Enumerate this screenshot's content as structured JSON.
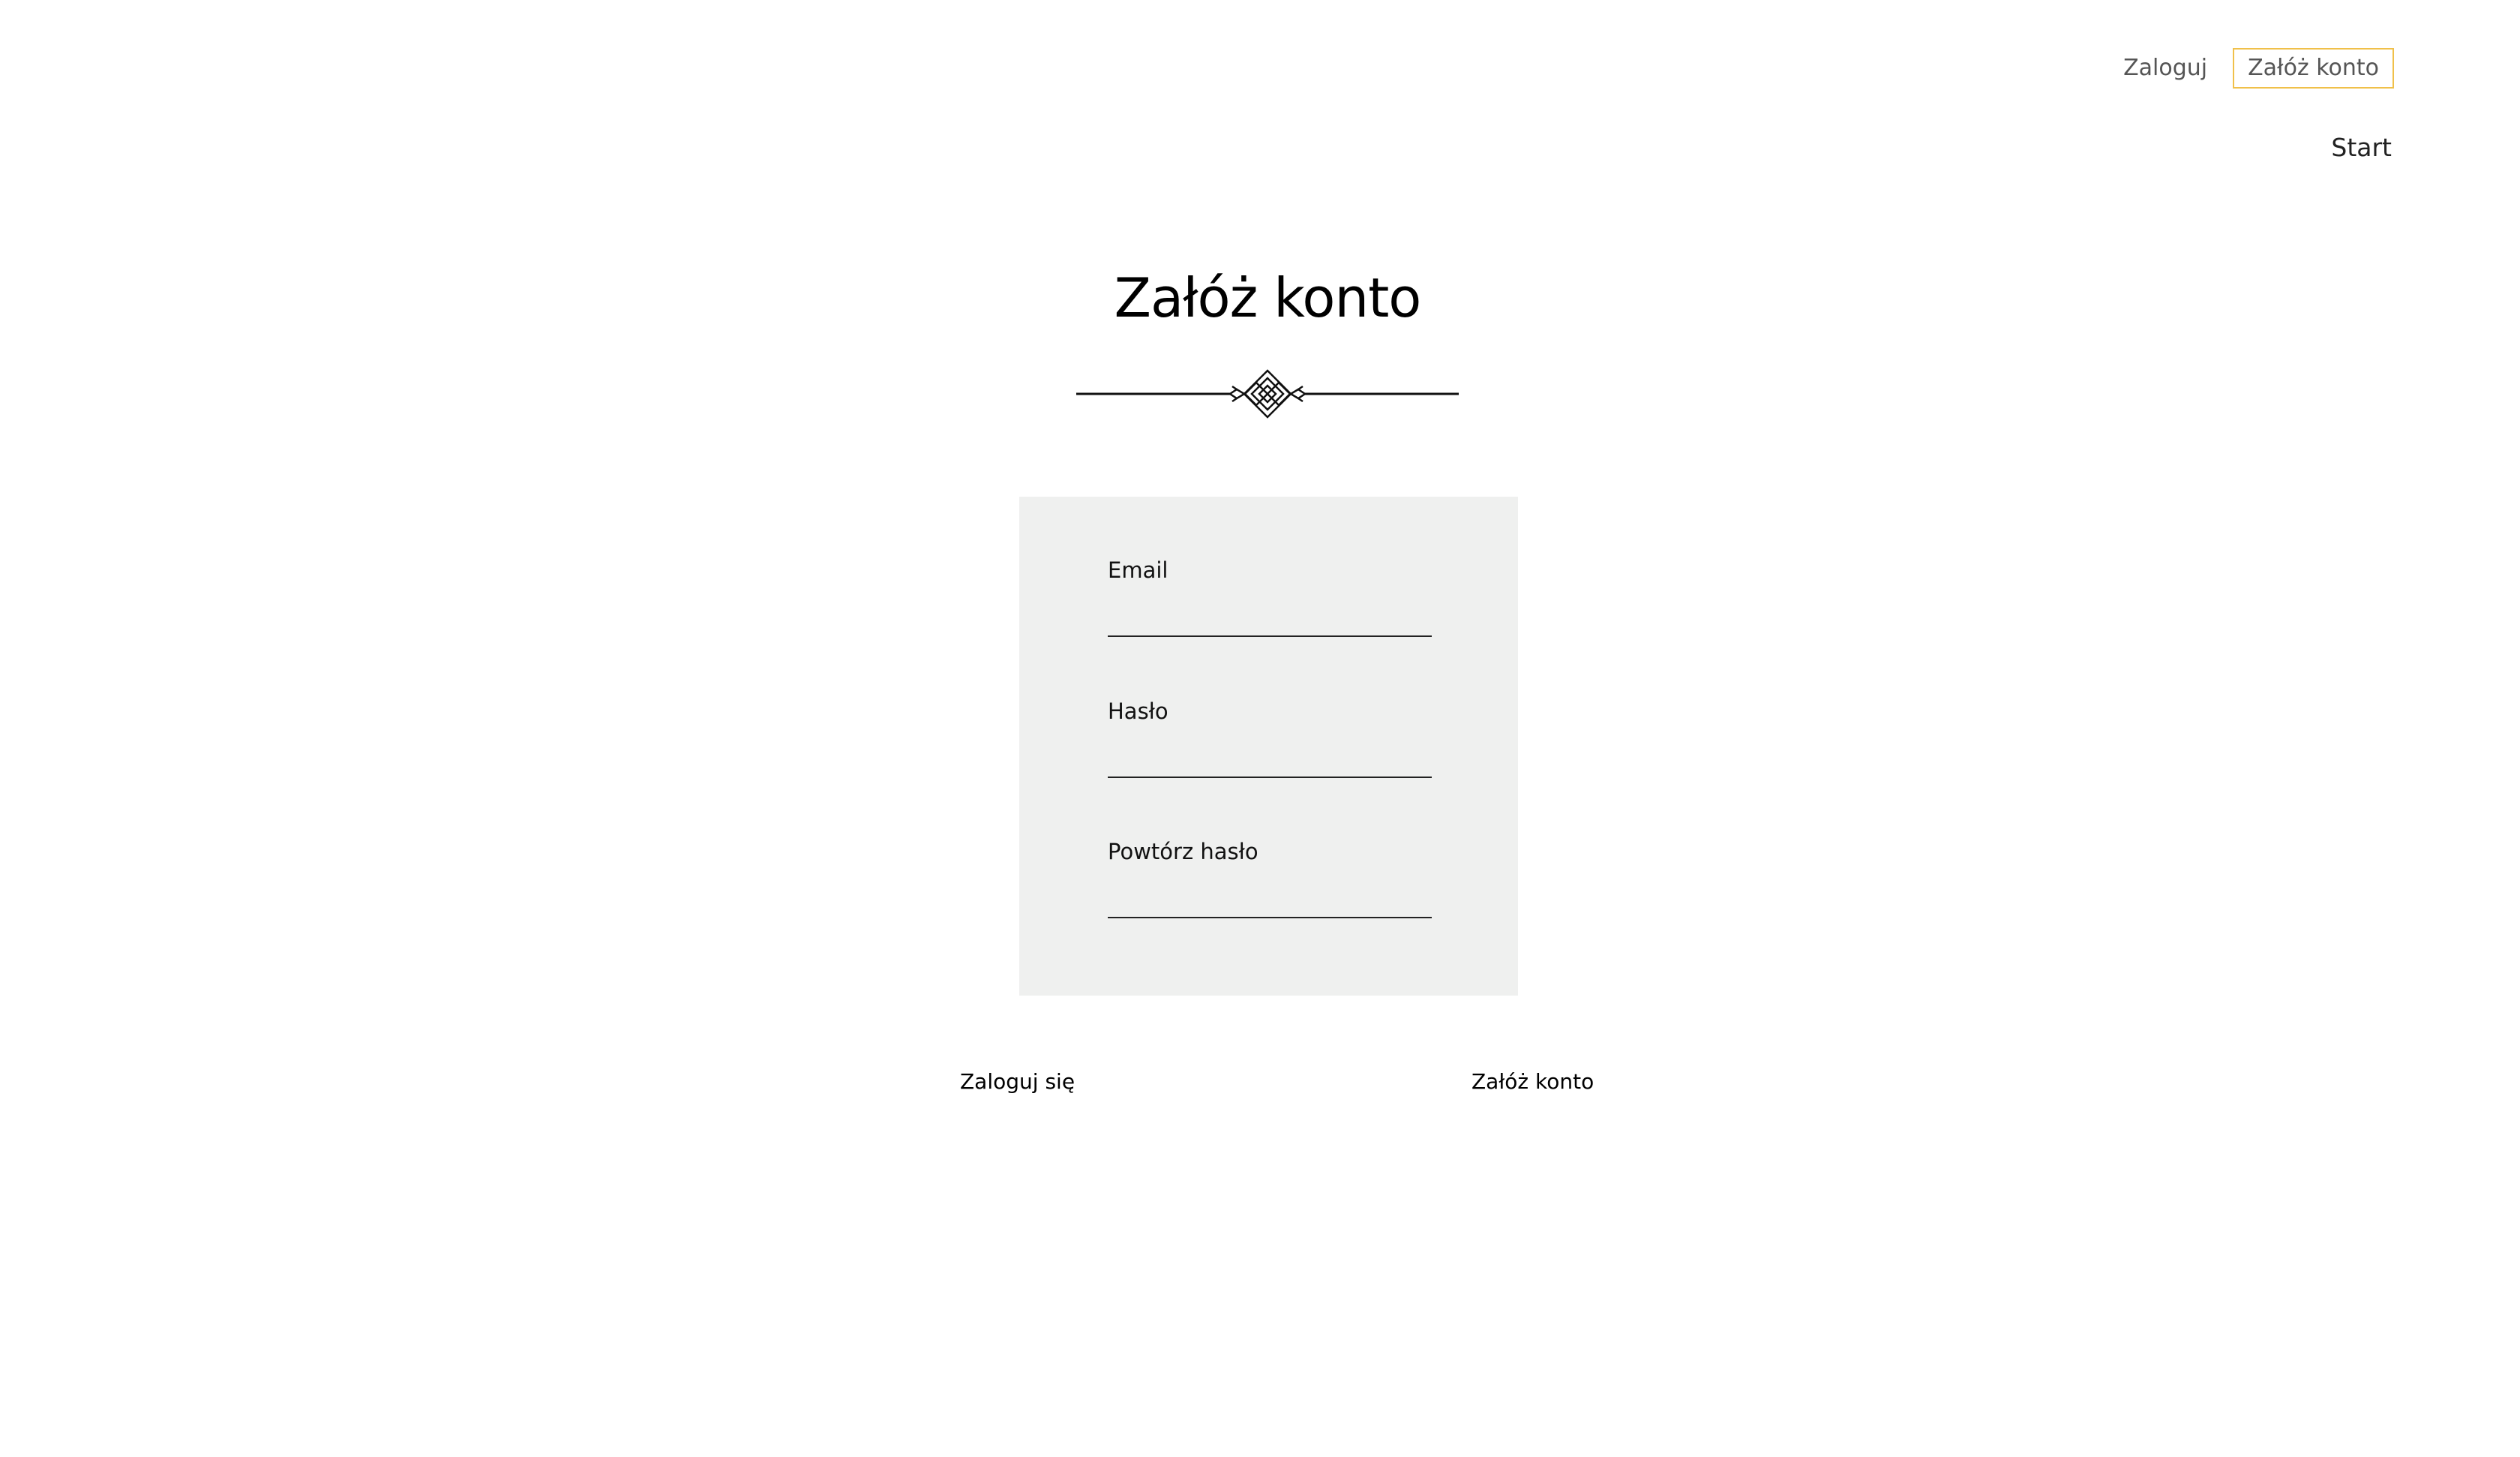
{
  "nav": {
    "login_label": "Zaloguj",
    "register_label": "Załóż konto"
  },
  "menu": {
    "start_label": "Start"
  },
  "page": {
    "title": "Załóż konto"
  },
  "form": {
    "fields": [
      {
        "label": "Email",
        "value": "",
        "type": "email"
      },
      {
        "label": "Hasło",
        "value": "",
        "type": "password"
      },
      {
        "label": "Powtórz hasło",
        "value": "",
        "type": "password"
      }
    ]
  },
  "actions": {
    "login_label": "Zaloguj się",
    "register_label": "Załóż konto"
  },
  "colors": {
    "accent_border": "#f0c04a",
    "panel_background": "#eff0ef",
    "nav_text": "#555555"
  },
  "icons": {
    "divider": "ornamental-divider-icon"
  }
}
